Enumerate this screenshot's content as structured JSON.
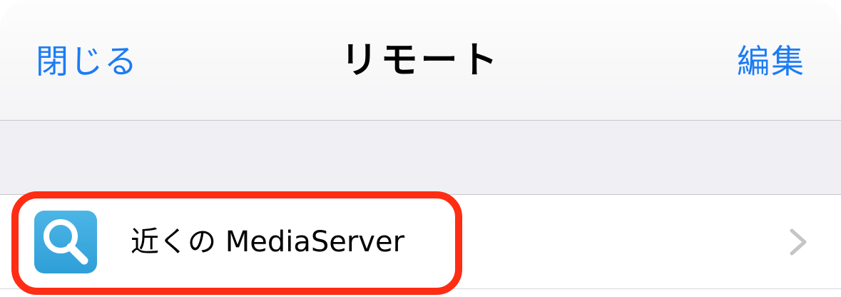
{
  "navbar": {
    "close_label": "閉じる",
    "title": "リモート",
    "edit_label": "編集"
  },
  "list": {
    "items": [
      {
        "label": "近くの MediaServer",
        "icon": "magnifier-icon"
      }
    ]
  },
  "colors": {
    "accent": "#1b7cf5",
    "highlight": "#ff2d13",
    "icon_bg": "#3aa9df",
    "separator": "#c8c8cc",
    "group_bg": "#efeff4"
  }
}
